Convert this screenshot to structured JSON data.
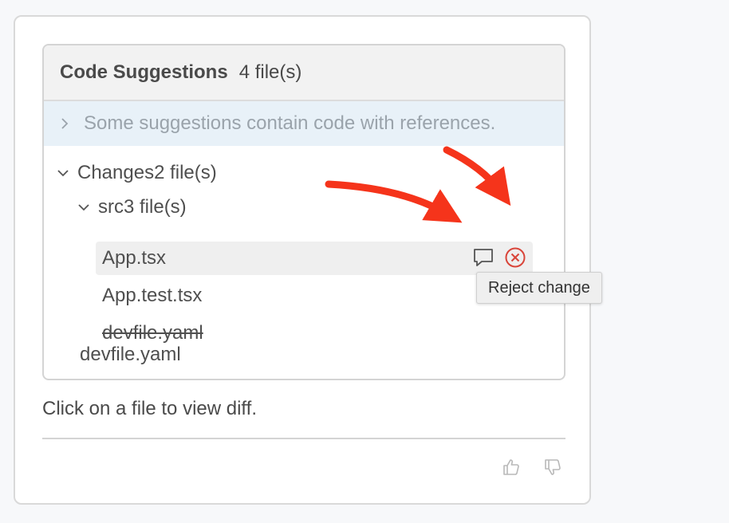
{
  "header": {
    "title": "Code Suggestions",
    "count": "4 file(s)"
  },
  "references": {
    "text": "Some suggestions contain code with references."
  },
  "tree": {
    "changes_label": "Changes2 file(s)",
    "src_label": "src3 file(s)",
    "files": [
      {
        "name": "App.tsx",
        "selected": true
      },
      {
        "name": "App.test.tsx"
      },
      {
        "name": "devfile.yaml",
        "struck": true
      }
    ],
    "root_file": "devfile.yaml"
  },
  "tooltip": {
    "text": "Reject change"
  },
  "hint": "Click on a file to view diff.",
  "icons": {
    "comment": "comment-icon",
    "reject": "reject-circle-x-icon",
    "thumbs_up": "thumbs-up-icon",
    "thumbs_down": "thumbs-down-icon",
    "chevron_right": "chevron-right-icon",
    "chevron_down": "chevron-down-icon"
  },
  "colors": {
    "reject": "#d9453a",
    "annotation_arrow": "#f5341b",
    "references_bg": "#e8f1f8"
  }
}
